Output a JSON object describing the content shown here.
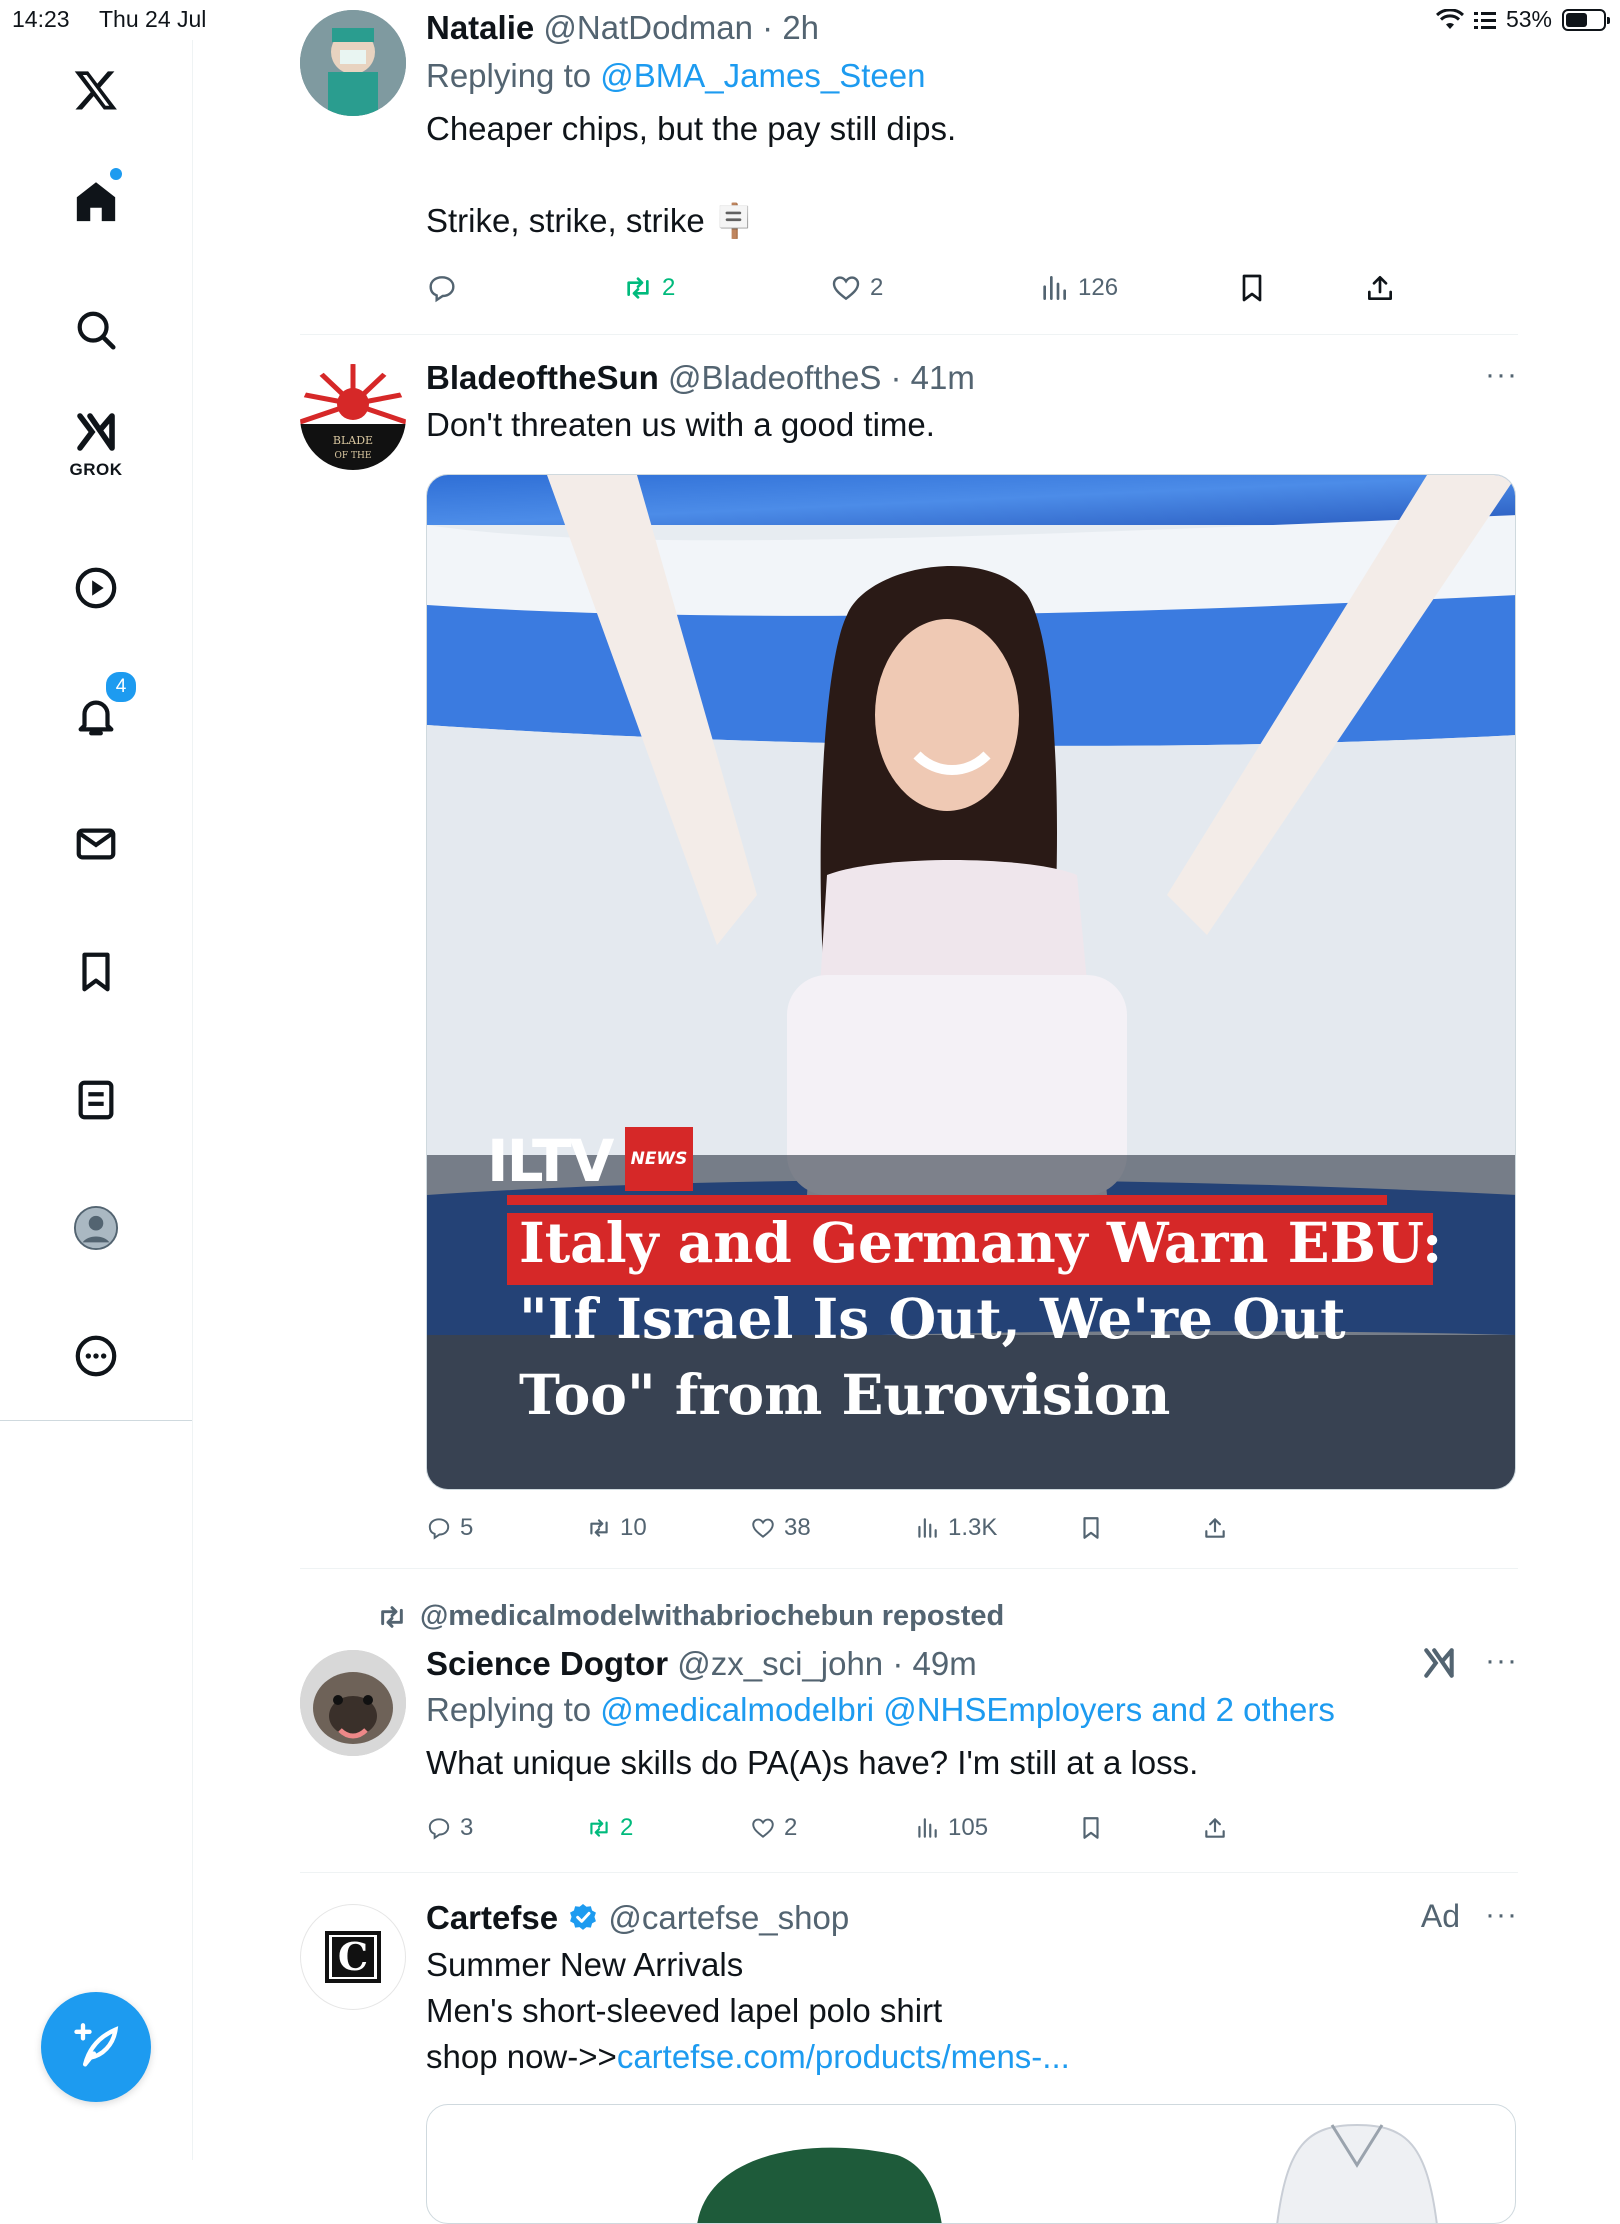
{
  "status_bar": {
    "time": "14:23",
    "date": "Thu 24 Jul",
    "battery": "53%",
    "battery_level": 0.53
  },
  "sidebar": {
    "grok_label": "GROK",
    "notifications_badge": "4",
    "items": [
      {
        "icon": "x-logo-icon"
      },
      {
        "icon": "home-icon"
      },
      {
        "icon": "search-icon"
      },
      {
        "icon": "grok-icon"
      },
      {
        "icon": "video-icon"
      },
      {
        "icon": "notifications-icon"
      },
      {
        "icon": "messages-icon"
      },
      {
        "icon": "bookmarks-icon"
      },
      {
        "icon": "lists-icon"
      },
      {
        "icon": "profile-icon"
      },
      {
        "icon": "more-icon"
      }
    ],
    "compose_icon": "compose-icon"
  },
  "posts": [
    {
      "name": "Natalie",
      "handle": "@NatDodman",
      "time": "2h",
      "replying_prefix": "Replying to",
      "replying_to": "@BMA_James_Steen",
      "text_line1": "Cheaper chips, but the pay still dips.",
      "text_line2": "Strike, strike, strike 🪧",
      "replies": "",
      "reposts": "2",
      "likes": "2",
      "views": "126"
    },
    {
      "name": "BladeoftheSun",
      "handle": "@BladeoftheS",
      "time": "41m",
      "text": "Don't threaten us with a good time.",
      "avatar_text": "BLADE OF THE",
      "media": {
        "logo": "ILTV",
        "logo_tag": "NEWS",
        "headline_line1": "Italy and Germany Warn EBU:",
        "headline_line2": "\"If Israel Is Out, We're Out",
        "headline_line3": "Too\" from Eurovision"
      },
      "replies": "5",
      "reposts": "10",
      "likes": "38",
      "views": "1.3K"
    },
    {
      "reposted_by": "@medicalmodelwithabriochebun reposted",
      "name": "Science Dogtor",
      "handle": "@zx_sci_john",
      "time": "49m",
      "replying_prefix": "Replying to",
      "replying_to": "@medicalmodelbri @NHSEmployers and 2 others",
      "text": "What unique skills do PA(A)s have? I'm still at a loss.",
      "replies": "3",
      "reposts": "2",
      "likes": "2",
      "views": "105"
    },
    {
      "name": "Cartefse",
      "handle": "@cartefse_shop",
      "ad_label": "Ad",
      "text_line1": "Summer New Arrivals",
      "text_line2": "Men's short-sleeved lapel polo shirt",
      "text_line3_prefix": "shop now->>",
      "text_line3_link": "cartefse.com/products/mens-...",
      "avatar_text": "C"
    }
  ],
  "colors": {
    "accent": "#1d9bf0",
    "repost_green": "#00ba7c",
    "secondary_text": "#536471",
    "divider": "#eff3f4"
  }
}
